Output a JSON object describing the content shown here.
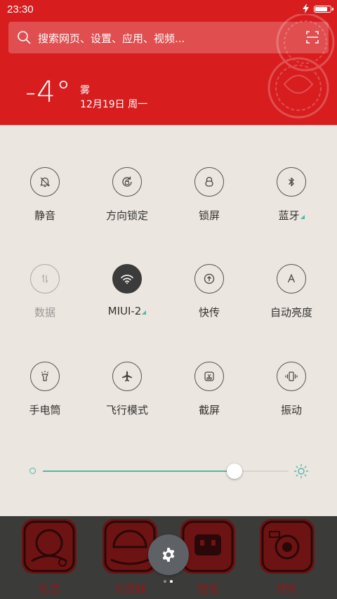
{
  "status_bar": {
    "time": "23:30",
    "charging_icon": "bolt-icon",
    "battery_level": 0.95
  },
  "search": {
    "placeholder": "搜索网页、设置、应用、视频..."
  },
  "weather": {
    "temperature": "-4°",
    "condition": "雾",
    "date": "12月19日 周一"
  },
  "toggles": [
    {
      "label": "静音",
      "icon": "bell-mute-icon",
      "state": "off"
    },
    {
      "label": "方向锁定",
      "icon": "rotation-lock-icon",
      "state": "off"
    },
    {
      "label": "锁屏",
      "icon": "lock-icon",
      "state": "off"
    },
    {
      "label": "蓝牙",
      "icon": "bluetooth-icon",
      "state": "off",
      "has_more": true
    },
    {
      "label": "数据",
      "icon": "data-arrows-icon",
      "state": "disabled"
    },
    {
      "label": "MIUI-2",
      "icon": "wifi-icon",
      "state": "on",
      "has_more": true
    },
    {
      "label": "快传",
      "icon": "quick-transfer-icon",
      "state": "off"
    },
    {
      "label": "自动亮度",
      "icon": "auto-brightness-icon",
      "state": "off"
    },
    {
      "label": "手电筒",
      "icon": "flashlight-icon",
      "state": "off"
    },
    {
      "label": "飞行模式",
      "icon": "airplane-icon",
      "state": "off"
    },
    {
      "label": "截屏",
      "icon": "screenshot-icon",
      "state": "off"
    },
    {
      "label": "振动",
      "icon": "vibrate-icon",
      "state": "off"
    }
  ],
  "brightness": {
    "level": 0.78
  },
  "dock": {
    "apps": [
      {
        "label": "电话",
        "icon": "phone-app-icon"
      },
      {
        "label": "浏览器",
        "icon": "browser-app-icon"
      },
      {
        "label": "短信",
        "icon": "messages-app-icon"
      },
      {
        "label": "相机",
        "icon": "camera-app-icon"
      }
    ],
    "settings_icon": "gear-icon",
    "pages": 2,
    "current_page": 2
  },
  "colors": {
    "header_red": "#d81d1f",
    "accent_teal": "#4fb6b0",
    "paper_bg": "#ebe6df",
    "dock_bg": "#3b3b39",
    "dock_label_red": "#8a1b1b",
    "toggle_active_bg": "#3b3b3b"
  }
}
